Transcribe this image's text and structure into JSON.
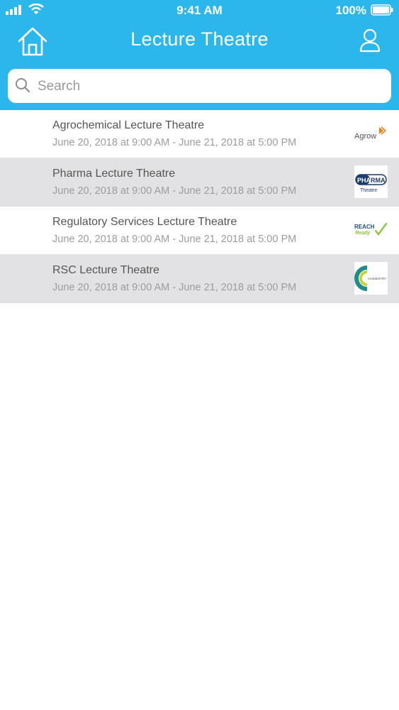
{
  "status_bar": {
    "time": "9:41 AM",
    "battery_percent": "100%"
  },
  "header": {
    "title": "Lecture Theatre",
    "home_icon": "home-icon",
    "profile_icon": "user-icon"
  },
  "search": {
    "placeholder": "Search",
    "value": ""
  },
  "colors": {
    "accent": "#2bb6ec",
    "shaded_row": "#e2e2e4"
  },
  "theatres": [
    {
      "name": "Agrochemical Lecture Theatre",
      "dates": "June 20, 2018 at 9:00 AM - June 21, 2018 at 5:00 PM",
      "logo_text": "Agrow"
    },
    {
      "name": "Pharma Lecture Theatre",
      "dates": "June 20, 2018 at 9:00 AM - June 21, 2018 at 5:00 PM",
      "logo_text": [
        "PHA",
        "RMA",
        "Theatre"
      ]
    },
    {
      "name": "Regulatory Services Lecture Theatre",
      "dates": "June 20, 2018 at 9:00 AM - June 21, 2018 at 5:00 PM",
      "logo_text": [
        "REACH",
        "Ready"
      ]
    },
    {
      "name": "RSC Lecture Theatre",
      "dates": "June 20, 2018 at 9:00 AM - June 21, 2018 at 5:00 PM",
      "logo_text": "CHEMISTRY"
    }
  ]
}
